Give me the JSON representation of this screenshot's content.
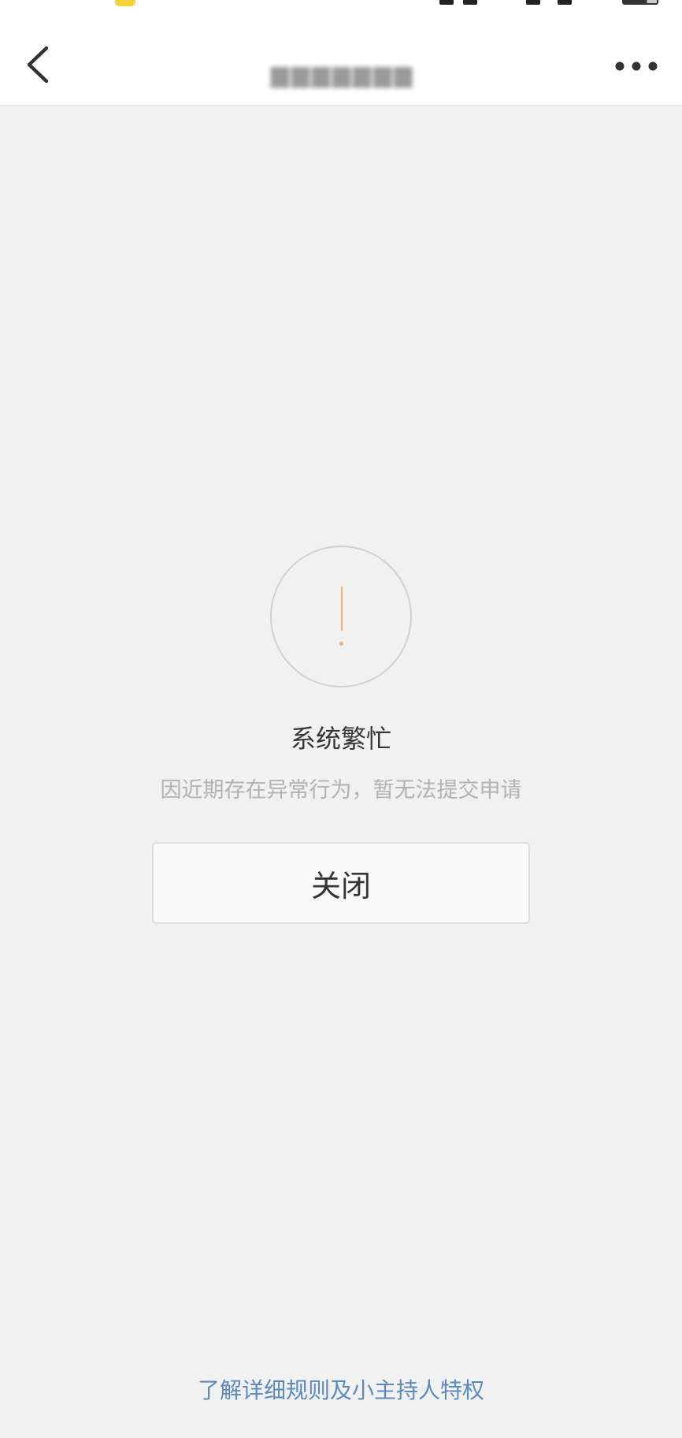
{
  "nav": {
    "title": "▆▆▆▆▆▆▆",
    "back_icon": "chevron-left-icon",
    "more_icon": "more-horizontal-icon"
  },
  "alert": {
    "icon": "exclamation-circle-icon",
    "title": "系统繁忙",
    "description": "因近期存在异常行为，暂无法提交申请",
    "accent_color": "#f3b06f"
  },
  "actions": {
    "close_label": "关闭"
  },
  "footer": {
    "rules_link": "了解详细规则及小主持人特权",
    "link_color": "#5b8bbd"
  }
}
